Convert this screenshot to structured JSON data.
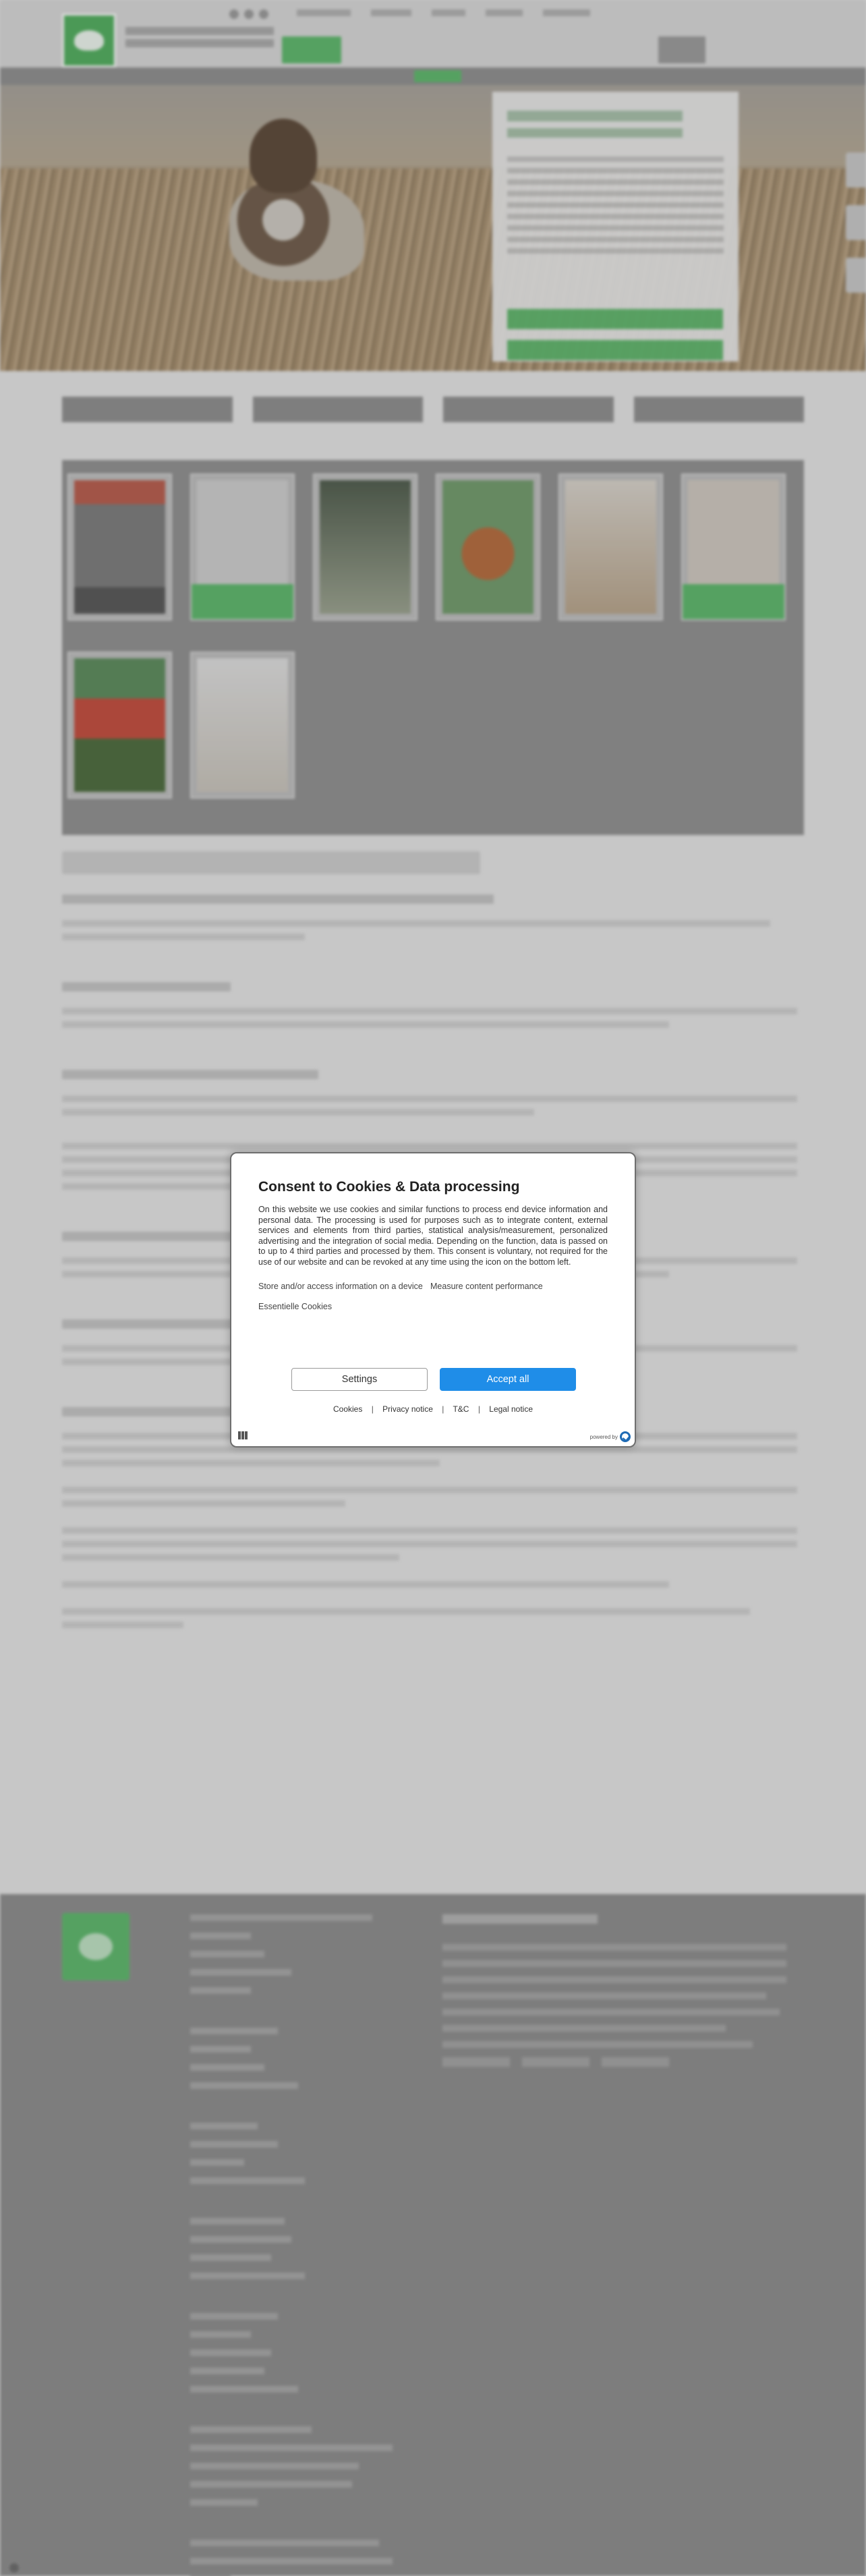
{
  "consent": {
    "title": "Consent to Cookies & Data processing",
    "description": "On this website we use cookies and similar functions to process end device information and personal data. The processing is used for purposes such as to integrate content, external services and elements from third parties, statistical analysis/measurement, personalized advertising and the integration of social media. Depending on the function, data is passed on to up to 4 third parties and processed by them. This consent is voluntary, not required for the use of our website and can be revoked at any time using the icon on the bottom left.",
    "purposes": [
      "Store and/or access information on a device",
      "Measure content performance",
      "Essentielle Cookies"
    ],
    "settings_label": "Settings",
    "accept_label": "Accept all",
    "links": [
      "Cookies",
      "Privacy notice",
      "T&C",
      "Legal notice"
    ],
    "separator": "|",
    "powered_by": "powered by"
  },
  "colors": {
    "accept_blue": "#1f8de8",
    "brand_green": "#5bb86a",
    "overlay_gray": "#8c8c8c"
  },
  "background_page": {
    "icons": [
      "brand-leaf-icon",
      "facebook-icon",
      "instagram-icon",
      "youtube-icon",
      "cookie-settings-icon",
      "usercentrics-logo-icon"
    ]
  }
}
